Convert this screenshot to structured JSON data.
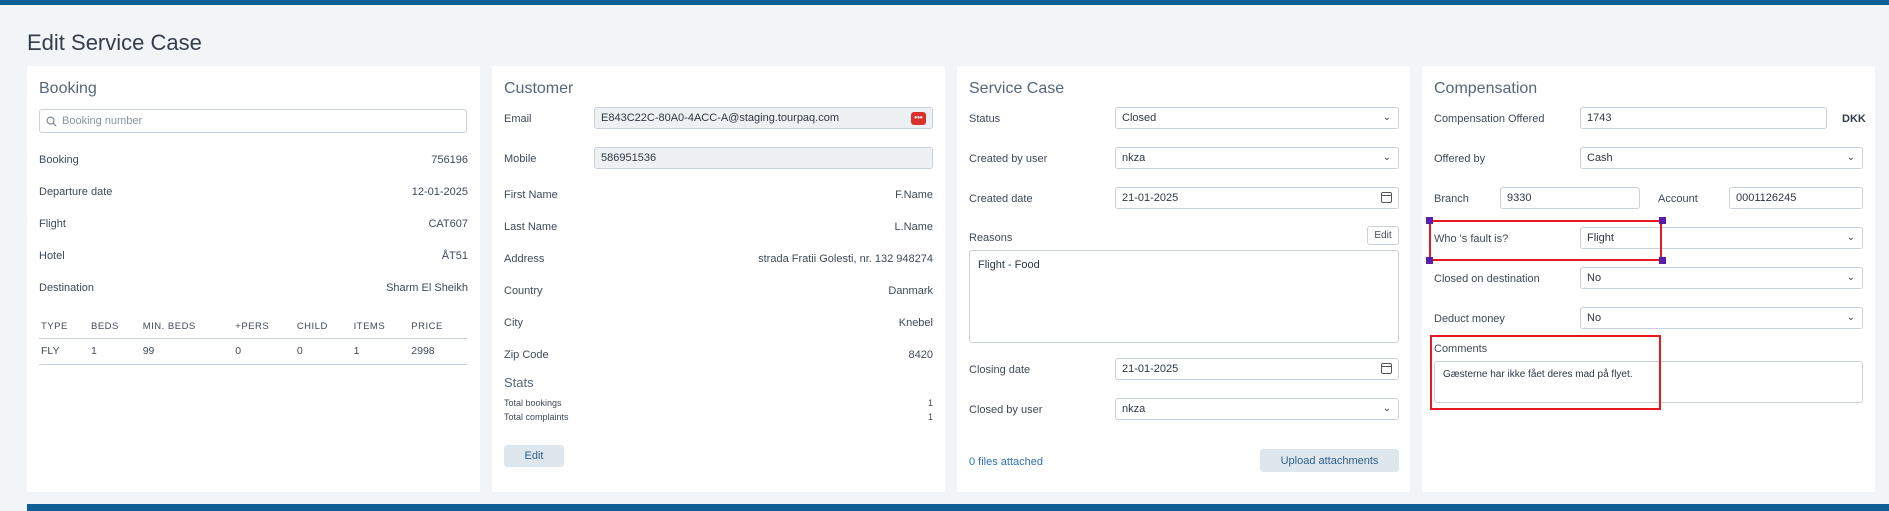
{
  "page": {
    "title": "Edit Service Case"
  },
  "booking": {
    "title": "Booking",
    "search_placeholder": "Booking number",
    "rows": [
      {
        "label": "Booking",
        "value": "756196"
      },
      {
        "label": "Departure date",
        "value": "12-01-2025"
      },
      {
        "label": "Flight",
        "value": "CAT607"
      },
      {
        "label": "Hotel",
        "value": "ÅT51"
      },
      {
        "label": "Destination",
        "value": "Sharm El Sheikh"
      }
    ],
    "table": {
      "headers": [
        "TYPE",
        "BEDS",
        "MIN. BEDS",
        "+PERS",
        "CHILD",
        "ITEMS",
        "PRICE"
      ],
      "rows": [
        [
          "FLY",
          "1",
          "99",
          "0",
          "0",
          "1",
          "2998"
        ]
      ]
    }
  },
  "customer": {
    "title": "Customer",
    "email_label": "Email",
    "email_value": "E843C22C-80A0-4ACC-A@staging.tourpaq.com",
    "mobile_label": "Mobile",
    "mobile_value": "586951536",
    "rows": [
      {
        "label": "First Name",
        "value": "F.Name"
      },
      {
        "label": "Last Name",
        "value": "L.Name"
      },
      {
        "label": "Address",
        "value": "strada Fratii Golesti, nr. 132 948274"
      },
      {
        "label": "Country",
        "value": "Danmark"
      },
      {
        "label": "City",
        "value": "Knebel"
      },
      {
        "label": "Zip Code",
        "value": "8420"
      }
    ],
    "stats_title": "Stats",
    "stats": [
      {
        "label": "Total bookings",
        "value": "1"
      },
      {
        "label": "Total complaints",
        "value": "1"
      }
    ],
    "edit_button": "Edit"
  },
  "service_case": {
    "title": "Service Case",
    "status_label": "Status",
    "status_value": "Closed",
    "created_by_label": "Created by user",
    "created_by_value": "nkza",
    "created_date_label": "Created date",
    "created_date_value": "21-01-2025",
    "reasons_label": "Reasons",
    "reasons_edit": "Edit",
    "reasons_value": "Flight - Food",
    "closing_date_label": "Closing date",
    "closing_date_value": "21-01-2025",
    "closed_by_label": "Closed by user",
    "closed_by_value": "nkza",
    "files_link": "0 files attached",
    "upload_button": "Upload attachments"
  },
  "compensation": {
    "title": "Compensation",
    "offered_label": "Compensation Offered",
    "offered_value": "1743",
    "currency": "DKK",
    "offered_by_label": "Offered by",
    "offered_by_value": "Cash",
    "branch_label": "Branch",
    "branch_value": "9330",
    "account_label": "Account",
    "account_value": "0001126245",
    "fault_label": "Who 's fault is?",
    "fault_value": "Flight",
    "closed_dest_label": "Closed on destination",
    "closed_dest_value": "No",
    "deduct_label": "Deduct money",
    "deduct_value": "No",
    "comments_label": "Comments",
    "comments_value": "Gæsterne har ikke fået deres mad på flyet."
  },
  "colors": {
    "accent": "#0f5f96",
    "highlight": "#e8191e",
    "handle": "#5a1fa8"
  }
}
